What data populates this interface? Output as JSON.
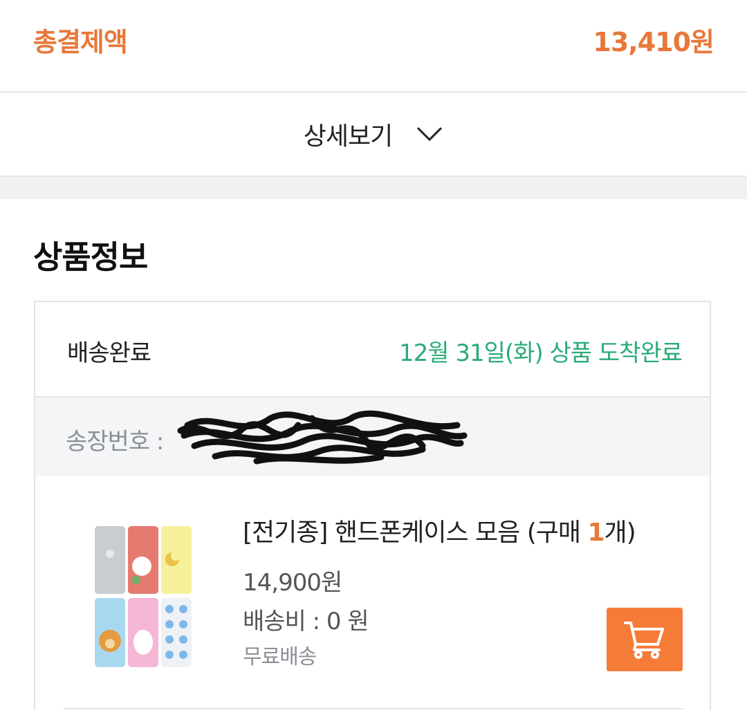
{
  "summary": {
    "total_label": "총결제액",
    "total_value": "13,410원",
    "detail_toggle_label": "상세보기",
    "accent_color": "#e8783a"
  },
  "product_section": {
    "title": "상품정보",
    "status_label": "배송완료",
    "status_text": "12월 31일(화) 상품 도착완료",
    "status_color": "#2bab78",
    "tracking_label": "송장번호 :",
    "item": {
      "name_prefix": "[전기종] 핸드폰케이스 모음 (구매 ",
      "quantity": "1",
      "name_suffix": "개)",
      "price": "14,900원",
      "shipping_fee": "배송비 : 0 원",
      "shipping_type": "무료배송",
      "thumbnail_icon": "phone-case-thumbnail",
      "cart_icon": "cart-icon"
    }
  }
}
